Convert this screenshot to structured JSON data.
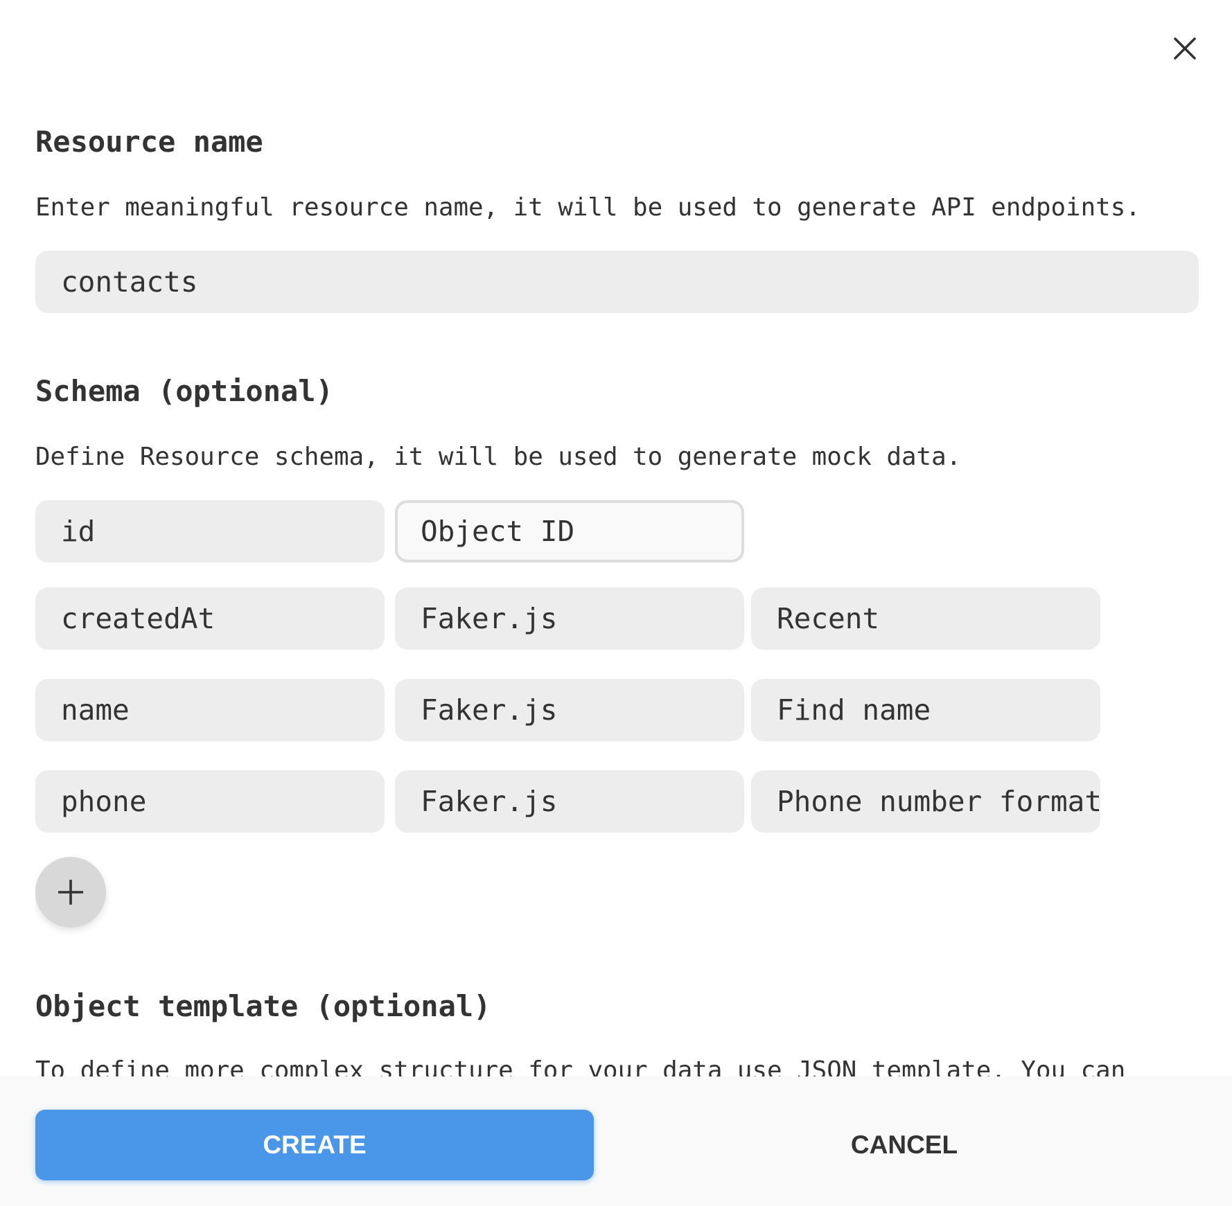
{
  "dialog": {
    "close_icon": "close-icon"
  },
  "resource": {
    "heading": "Resource name",
    "description": "Enter meaningful resource name, it will be used to generate API endpoints.",
    "value": "contacts"
  },
  "schema": {
    "heading": "Schema (optional)",
    "description": "Define Resource schema, it will be used to generate mock data.",
    "rows": [
      {
        "name": "id",
        "type": "Object ID",
        "option": null,
        "active": true
      },
      {
        "name": "createdAt",
        "type": "Faker.js",
        "option": "Recent"
      },
      {
        "name": "name",
        "type": "Faker.js",
        "option": "Find name"
      },
      {
        "name": "phone",
        "type": "Faker.js",
        "option": "Phone number format"
      }
    ],
    "add_icon": "plus-icon"
  },
  "template": {
    "heading": "Object template (optional)",
    "description": "To define more complex structure for your data use JSON template. You can"
  },
  "footer": {
    "create_label": "CREATE",
    "cancel_label": "CANCEL"
  },
  "colors": {
    "primary": "#4a96e8",
    "field_bg": "#ededed",
    "text": "#333333",
    "footer_bg": "#f9f9f9"
  }
}
